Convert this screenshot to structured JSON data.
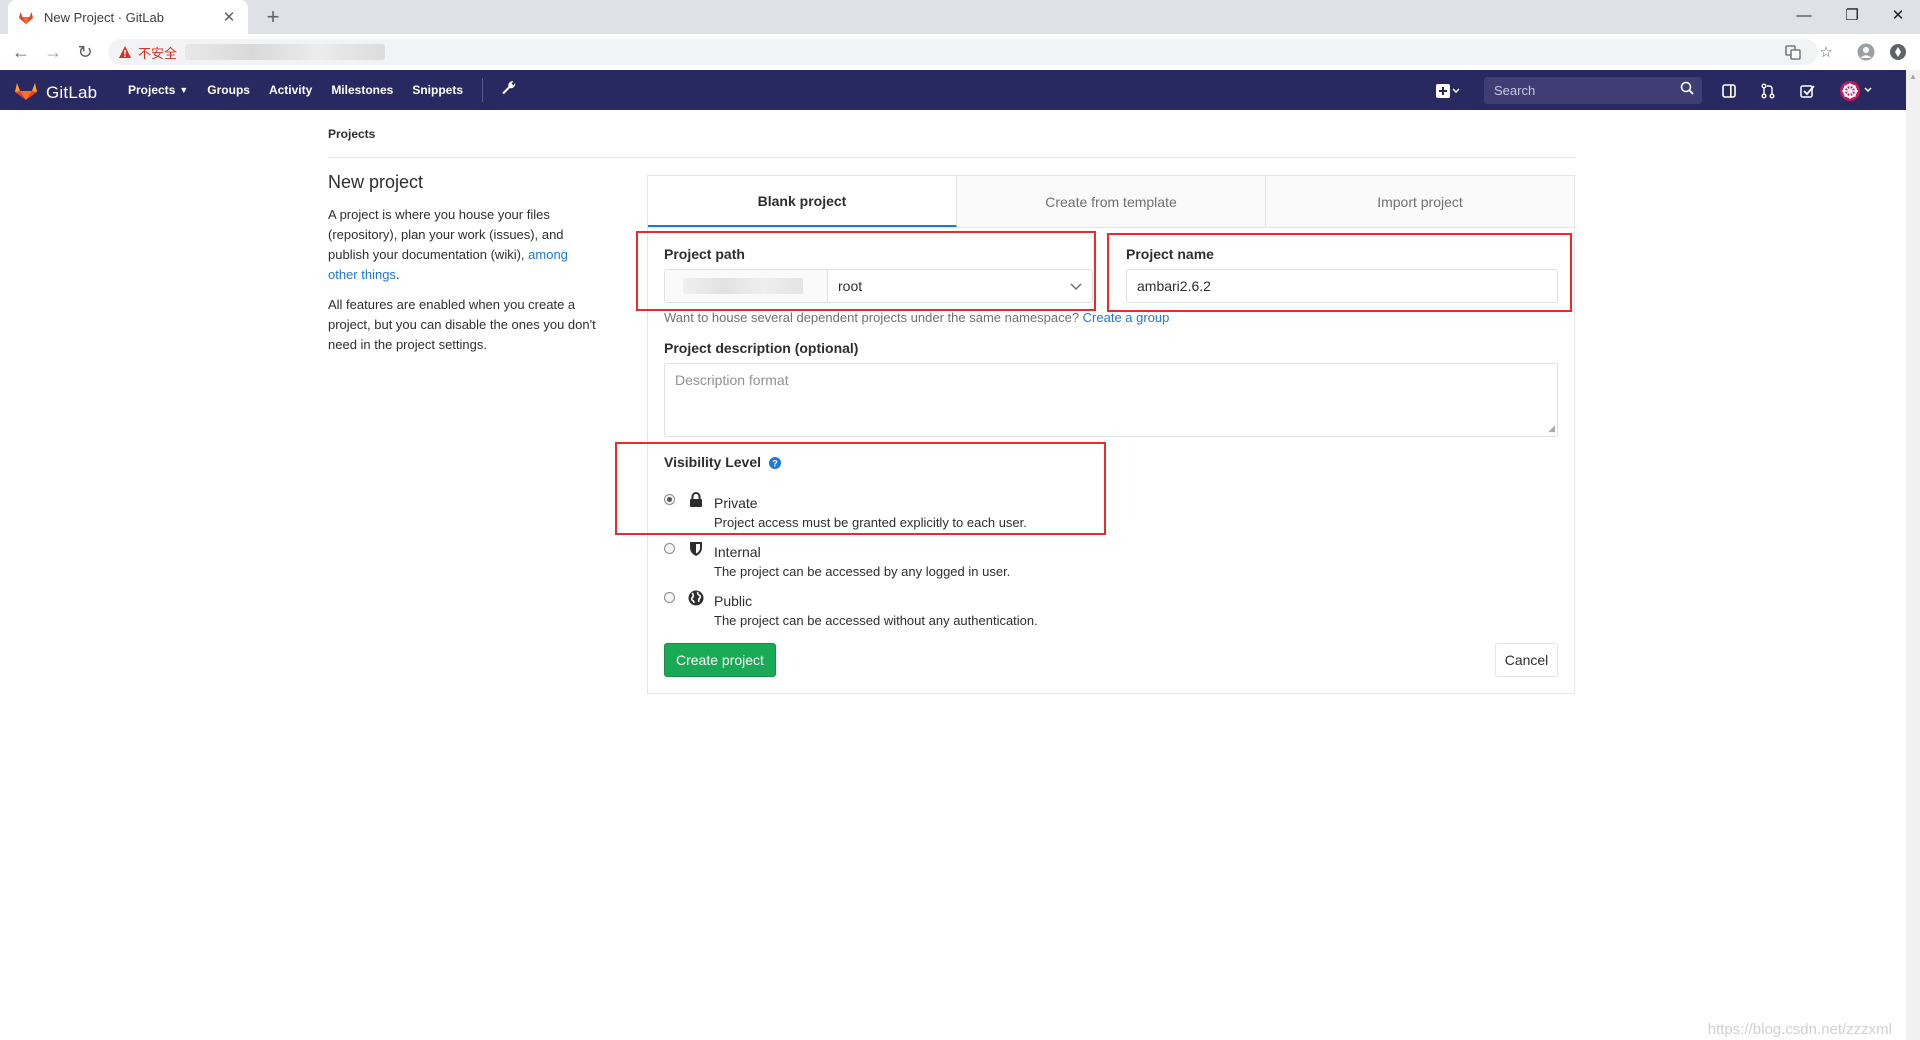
{
  "browser": {
    "tab_title": "New Project · GitLab",
    "insecure_label": "不安全"
  },
  "gitlab": {
    "logo_text": "GitLab",
    "nav": [
      "Projects",
      "Groups",
      "Activity",
      "Milestones",
      "Snippets"
    ],
    "search_placeholder": "Search"
  },
  "breadcrumb": "Projects",
  "intro": {
    "title": "New project",
    "p1_text": "A project is where you house your files (repository), plan your work (issues), and publish your documentation (wiki), ",
    "p1_link": "among other things",
    "p1_end": ".",
    "p2": "All features are enabled when you create a project, but you can disable the ones you don't need in the project settings."
  },
  "tabs": [
    "Blank project",
    "Create from template",
    "Import project"
  ],
  "form": {
    "path_label": "Project path",
    "namespace": "root",
    "name_label": "Project name",
    "name_value": "ambari2.6.2",
    "help_text": "Want to house several dependent projects under the same namespace? ",
    "help_link": "Create a group",
    "desc_label": "Project description (optional)",
    "desc_placeholder": "Description format",
    "visibility_label": "Visibility Level",
    "visibility": [
      {
        "title": "Private",
        "desc": "Project access must be granted explicitly to each user.",
        "icon": "lock-icon",
        "checked": true
      },
      {
        "title": "Internal",
        "desc": "The project can be accessed by any logged in user.",
        "icon": "shield-icon",
        "checked": false
      },
      {
        "title": "Public",
        "desc": "The project can be accessed without any authentication.",
        "icon": "globe-icon",
        "checked": false
      }
    ],
    "create_label": "Create project",
    "cancel_label": "Cancel"
  },
  "watermark": "https://blog.csdn.net/zzzxml",
  "colors": {
    "header": "#292961",
    "primary_button": "#1aaa55",
    "link": "#1f78d1",
    "highlight": "#e52d2d"
  }
}
